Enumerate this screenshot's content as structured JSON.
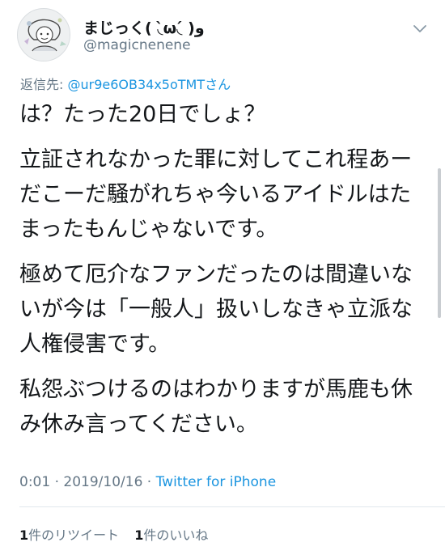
{
  "user": {
    "display_name": "まじっく( ◟̀ω◟́ )و",
    "handle": "@magicnenene"
  },
  "reply": {
    "prefix": "返信先: ",
    "mention": "@ur9e6OB34x5oTMTさん"
  },
  "tweet": {
    "paragraphs": [
      "は？たった20日でしょ？",
      "立証されなかった罪に対してこれ程あーだこーだ騒がれちゃ今いるアイドルはたまったもんじゃないです。",
      "極めて厄介なファンだったのは間違いないが今は「一般人」扱いしなきゃ立派な人権侵害です。",
      "私怨ぶつけるのはわかりますが馬鹿も休み休み言ってください。"
    ]
  },
  "meta": {
    "time": "0:01",
    "separator1": " · ",
    "date": "2019/10/16",
    "separator2": " · ",
    "source": "Twitter for iPhone"
  },
  "stats": {
    "retweets_count": "1",
    "retweets_label": "件のリツイート",
    "likes_count": "1",
    "likes_label": "件のいいね"
  },
  "icons": {
    "menu": "chevron-down-icon",
    "avatar": "avatar-illustration"
  },
  "colors": {
    "link": "#1b95e0",
    "secondary_text": "#657786",
    "primary_text": "#14171a",
    "divider": "#e1e8ed"
  }
}
